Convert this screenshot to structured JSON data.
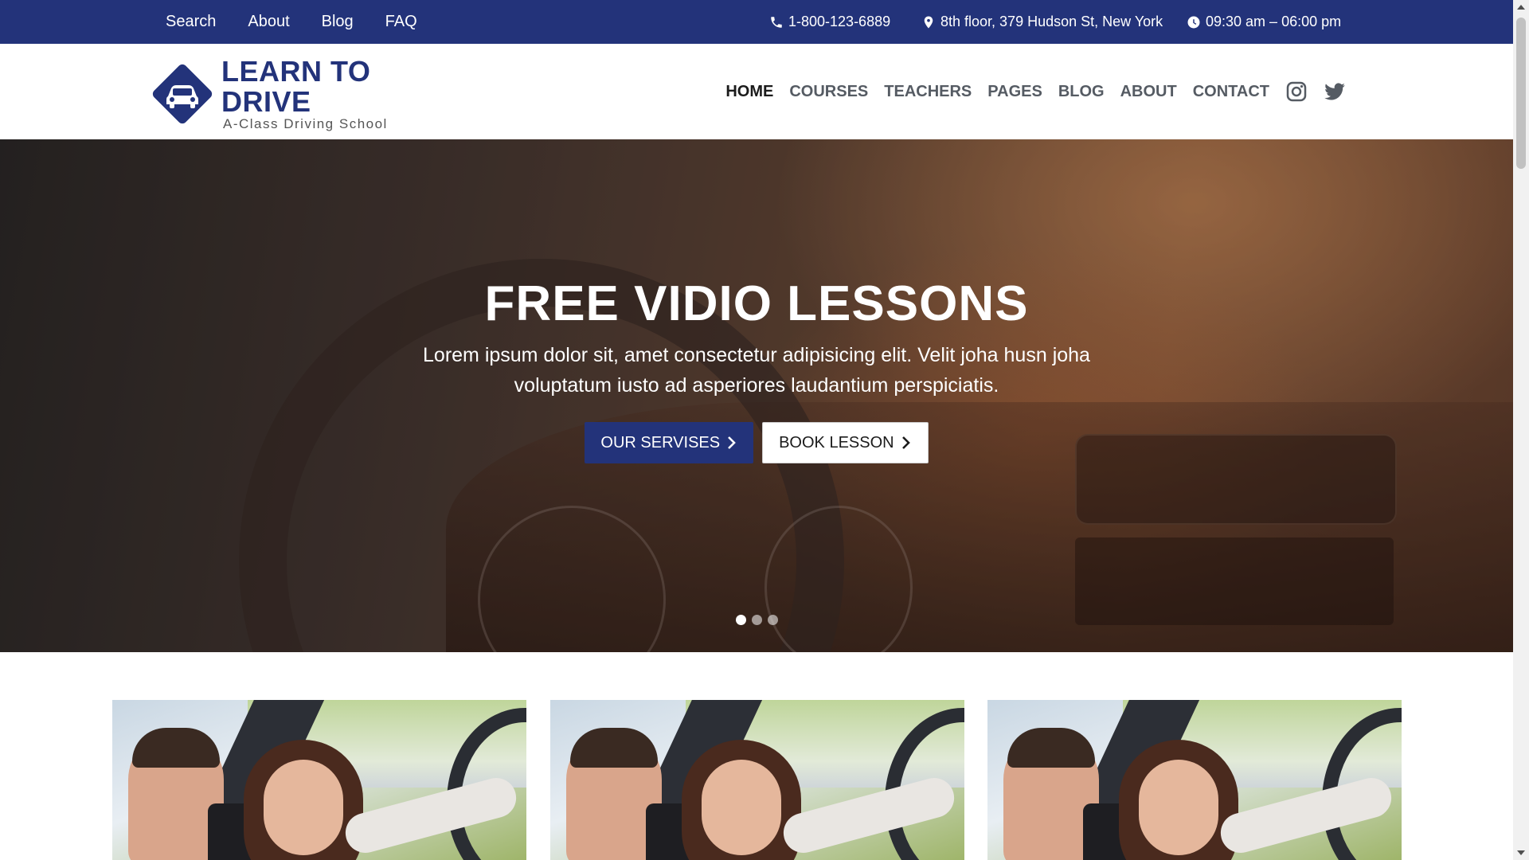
{
  "topbar": {
    "links": [
      "Search",
      "About",
      "Blog",
      "FAQ"
    ],
    "phone": "1-800-123-6889",
    "address": "8th floor, 379 Hudson St, New York",
    "hours": "09:30 am – 06:00 pm"
  },
  "logo": {
    "brand": "LEARN TO DRIVE",
    "tagline": "A-Class Driving School"
  },
  "nav": {
    "items": [
      "HOME",
      "COURSES",
      "TEACHERS",
      "PAGES",
      "BLOG",
      "ABOUT",
      "CONTACT"
    ],
    "active_index": 0
  },
  "hero": {
    "title": "FREE VIDIO LESSONS",
    "text": "Lorem ipsum dolor sit, amet consectetur adipisicing elit. Velit joha husn joha voluptatum iusto ad asperiores laudantium perspiciatis.",
    "primary_button": "OUR SERVISES",
    "secondary_button": "BOOK LESSON",
    "slides": 3,
    "active_slide": 1
  },
  "colors": {
    "brand": "#23337a",
    "nav_text": "#555b63",
    "active_nav": "#1b1b1b"
  },
  "icons": [
    "phone-icon",
    "map-pin-icon",
    "clock-icon",
    "car-logo-icon",
    "instagram-icon",
    "twitter-icon",
    "chevron-right-icon"
  ]
}
